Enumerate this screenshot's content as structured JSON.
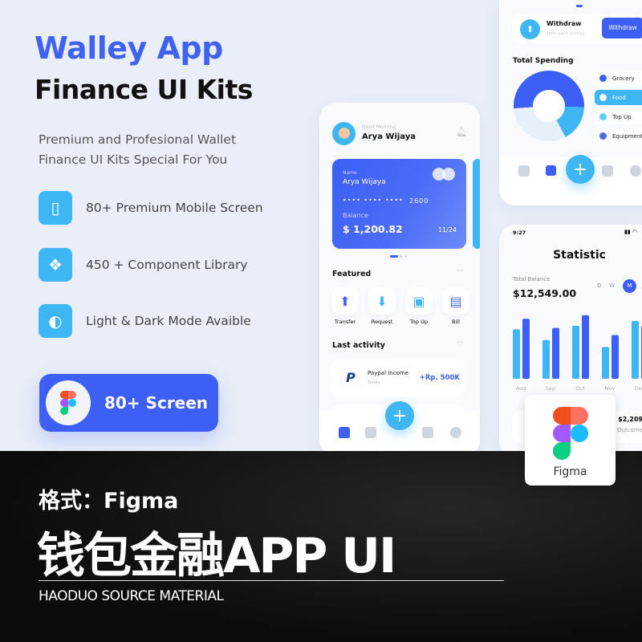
{
  "hero": {
    "title": "Walley App",
    "subtitle": "Finance UI Kits",
    "description_line1": "Premium and Profesional Wallet",
    "description_line2": "Finance UI Kits Special For You"
  },
  "features": [
    {
      "icon": "phone-icon",
      "label": "80+ Premium Mobile Screen"
    },
    {
      "icon": "components-icon",
      "label": "450 + Component Library"
    },
    {
      "icon": "drop-icon",
      "label": "Light & Dark Mode Avaible"
    }
  ],
  "cta": {
    "label": "80+ Screen",
    "icon": "figma-logo"
  },
  "home": {
    "greeting": "Good Morning",
    "user": "Arya Wijaya",
    "card": {
      "name_label": "Name",
      "name": "Arya Wijaya",
      "number_mask": "•••• •••• ••••",
      "number_last": "2600",
      "balance_label": "Balance",
      "balance": "$ 1,200.82",
      "expiry": "11/24"
    },
    "featured_title": "Featured",
    "featured": [
      "Transfer",
      "Request",
      "Top Up",
      "Bill"
    ],
    "activity_title": "Last activity",
    "activity": {
      "title": "Paypal Income",
      "date": "Today",
      "amount": "+Rp. 500K"
    }
  },
  "spending": {
    "withdraw_title": "Withdraw",
    "withdraw_sub": "Take back money",
    "withdraw_button": "Withdraw",
    "title": "Total Spending",
    "legend": [
      {
        "label": "Grocery",
        "color": "#3d5ff5"
      },
      {
        "label": "Food",
        "color": "#ffffff"
      },
      {
        "label": "Top Up",
        "color": "#5fd0f7"
      },
      {
        "label": "Equipment",
        "color": "#4b6fe8"
      }
    ]
  },
  "statistic": {
    "time": "9:27",
    "title": "Statistic",
    "balance_label": "Total Balance",
    "balance": "$12,549.00",
    "periods": [
      "D",
      "W",
      "M"
    ],
    "active_period": "M",
    "partial_value": "$2,209",
    "partial_label": "Outcome"
  },
  "chart_data": {
    "type": "bar",
    "categories": [
      "Aug",
      "Sep",
      "Oct",
      "Nov",
      "Dec"
    ],
    "series": [
      {
        "values": [
          70,
          55,
          75,
          45,
          82
        ]
      },
      {
        "values": [
          85,
          72,
          90,
          62,
          75
        ]
      }
    ],
    "colors": [
      "#3fb6f4",
      "#3d5ff5"
    ]
  },
  "figma_badge": {
    "label": "Figma"
  },
  "banner": {
    "format": "格式：Figma",
    "title": "钱包金融APP UI",
    "footer": "HAODUO SOURCE MATERIAL"
  }
}
